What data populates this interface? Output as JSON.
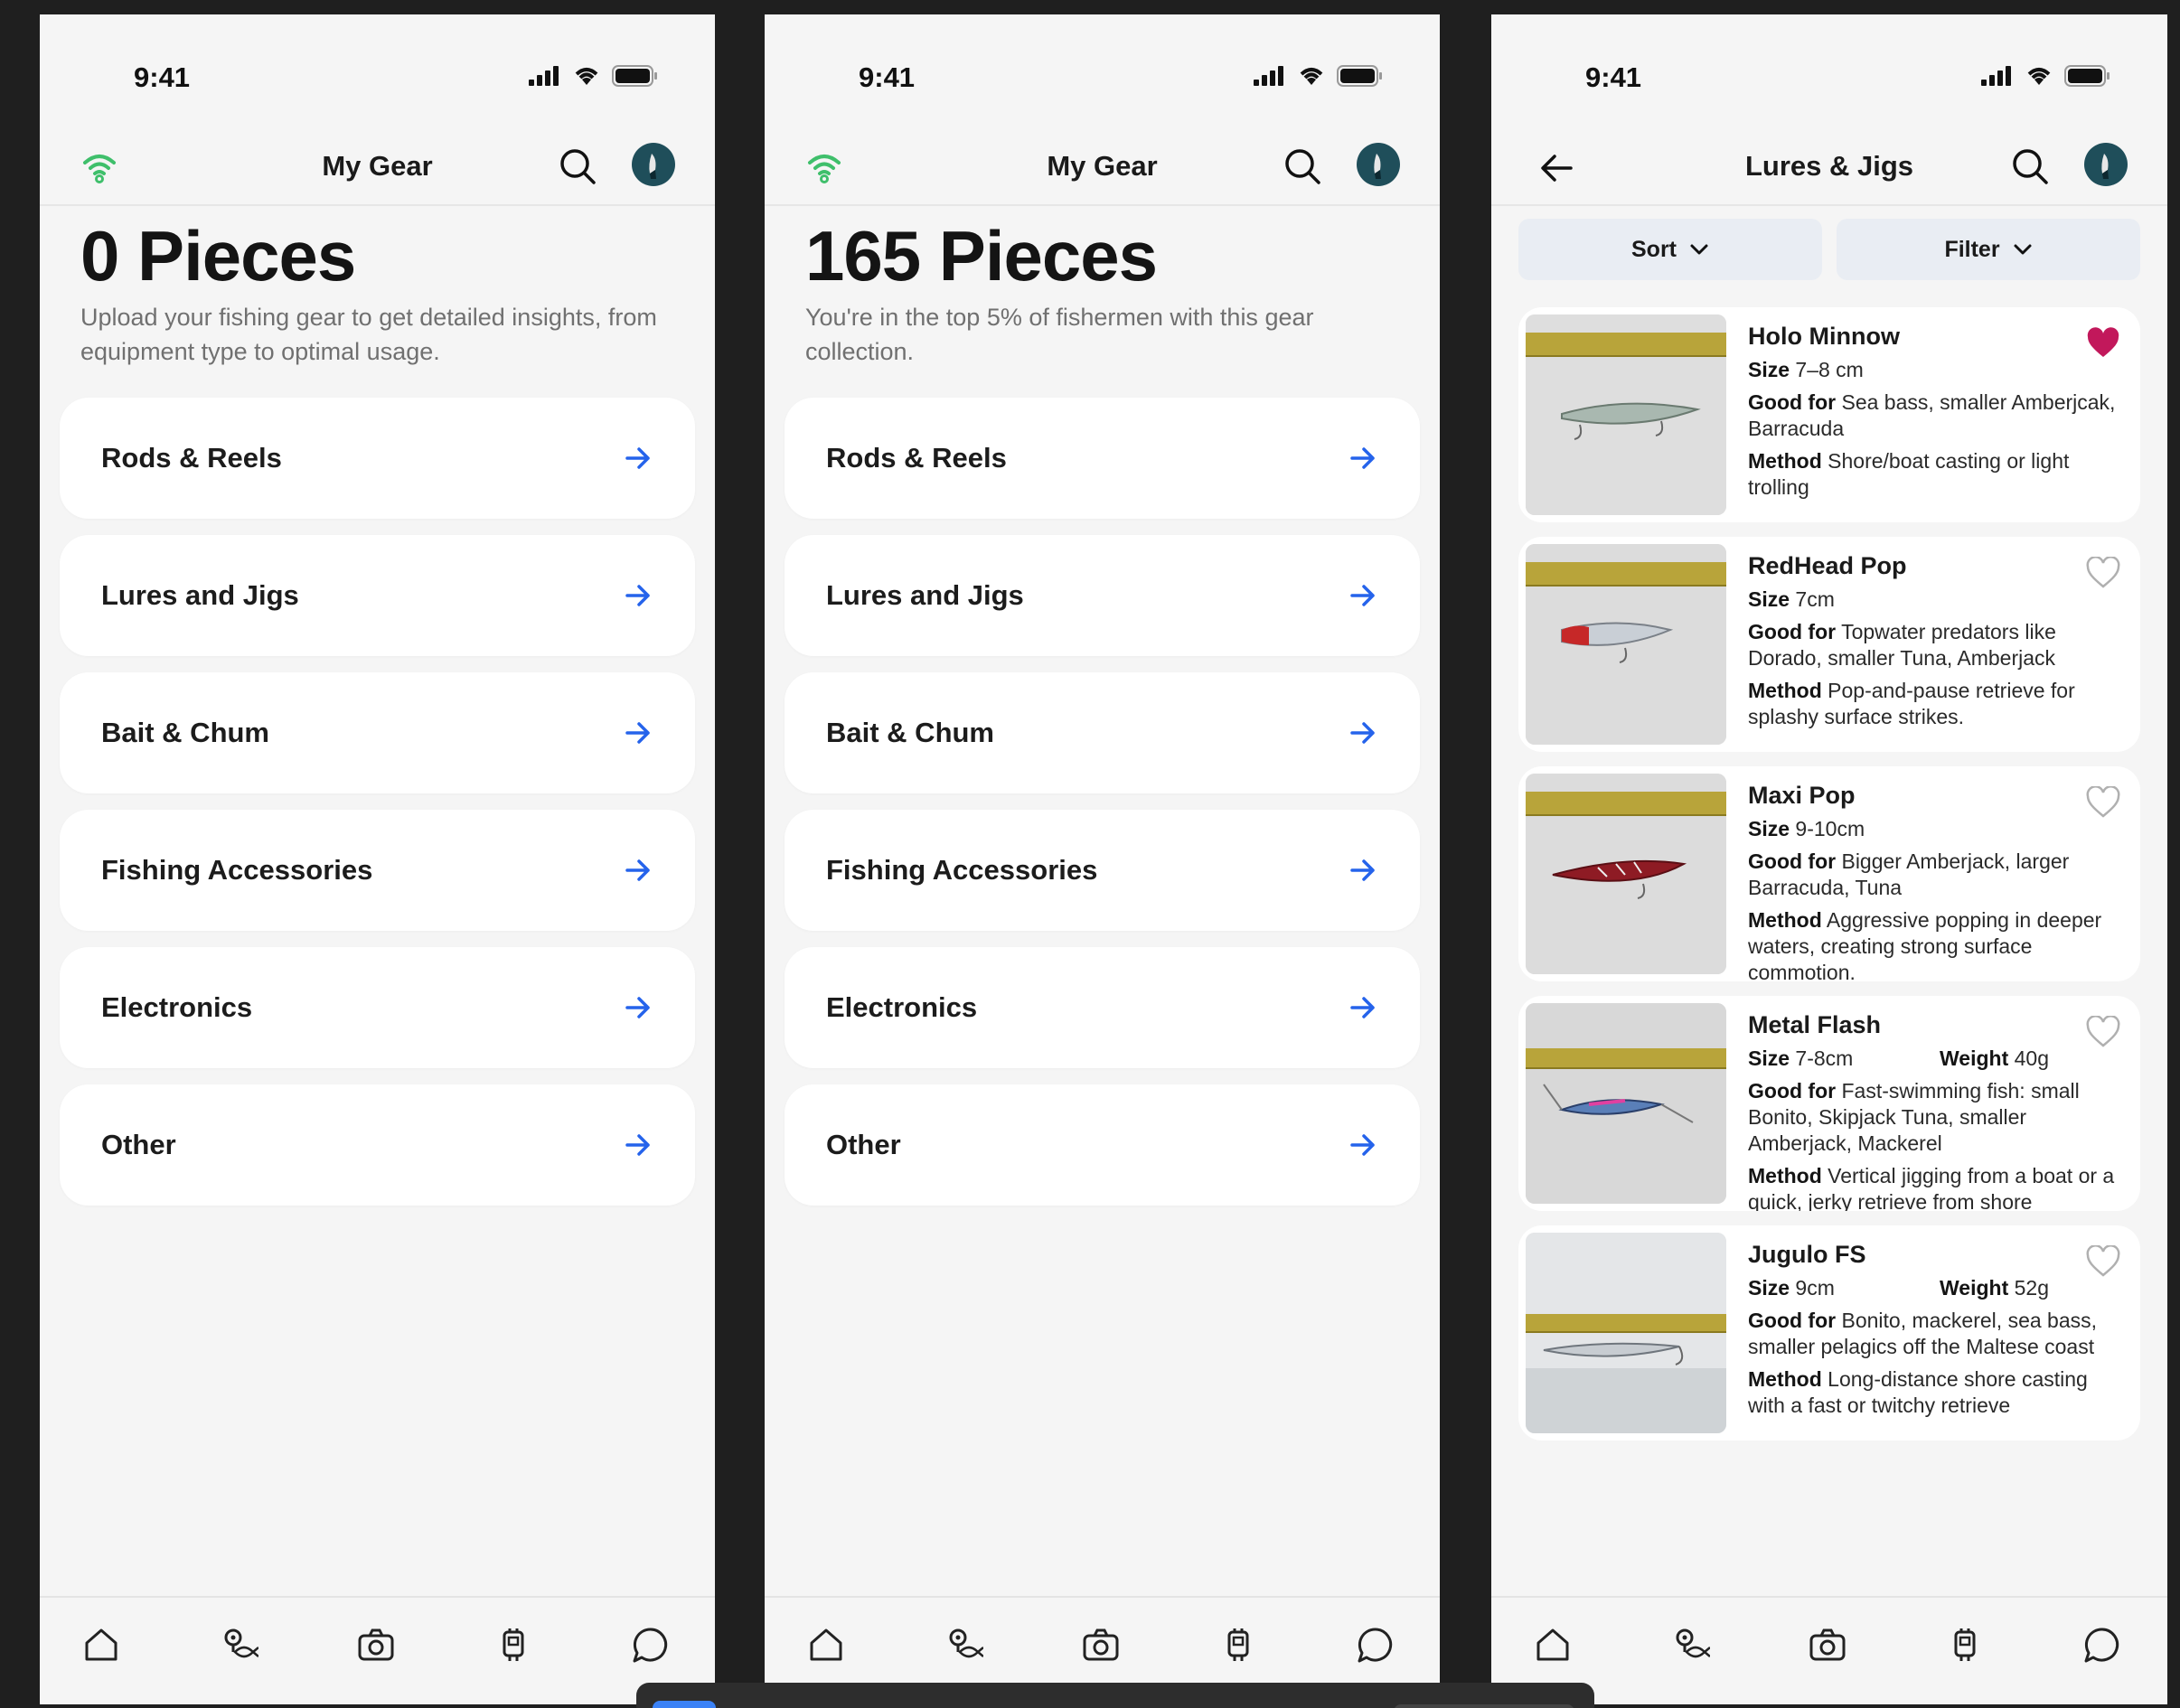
{
  "status": {
    "time": "9:41"
  },
  "screens": [
    {
      "nav_title": "My Gear",
      "count_title": "0 Pieces",
      "subtitle": "Upload your fishing gear to get detailed insights, from equipment type to optimal usage.",
      "categories": [
        "Rods & Reels",
        "Lures and Jigs",
        "Bait & Chum",
        "Fishing Accessories",
        "Electronics",
        "Other"
      ]
    },
    {
      "nav_title": "My Gear",
      "count_title": "165 Pieces",
      "subtitle": "You're in the top 5% of fishermen with this gear collection.",
      "categories": [
        "Rods & Reels",
        "Lures and Jigs",
        "Bait & Chum",
        "Fishing Accessories",
        "Electronics",
        "Other"
      ]
    },
    {
      "nav_title": "Lures & Jigs",
      "sort_label": "Sort",
      "filter_label": "Filter",
      "labels": {
        "size": "Size",
        "weight": "Weight",
        "good_for": "Good for",
        "method": "Method"
      },
      "lures": [
        {
          "name": "Holo Minnow",
          "size": "7–8 cm",
          "good_for": "Sea bass, smaller Amberjcak, Barracuda",
          "method": "Shore/boat casting or light trolling",
          "favorite": true
        },
        {
          "name": "RedHead Pop",
          "size": "7cm",
          "good_for": "Topwater predators like Dorado, smaller Tuna, Amberjack",
          "method": "Pop-and-pause retrieve for splashy surface strikes.",
          "favorite": false
        },
        {
          "name": "Maxi Pop",
          "size": "9-10cm",
          "good_for": "Bigger Amberjack, larger Barracuda, Tuna",
          "method": "Aggressive popping in deeper waters, creating strong surface commotion.",
          "favorite": false
        },
        {
          "name": "Metal Flash",
          "size": "7-8cm",
          "weight": "40g",
          "good_for": "Fast-swimming fish: small Bonito, Skipjack Tuna, smaller Amberjack, Mackerel",
          "method": "Vertical jigging from a boat or a quick, jerky retrieve from shore",
          "favorite": false
        },
        {
          "name": "Jugulo FS",
          "size": "9cm",
          "weight": "52g",
          "good_for": "Bonito, mackerel, sea bass, smaller pelagics off the Maltese coast",
          "method": "Long-distance shore casting with a fast or twitchy retrieve",
          "favorite": false
        }
      ]
    }
  ],
  "tabs": [
    "home-icon",
    "fish-location-icon",
    "camera-icon",
    "gear-icon",
    "chat-icon"
  ],
  "colors": {
    "accent": "#2563eb",
    "wifi_green": "#3fbf6b",
    "heart": "#c2185b",
    "avatar": "#1f4e5a"
  }
}
